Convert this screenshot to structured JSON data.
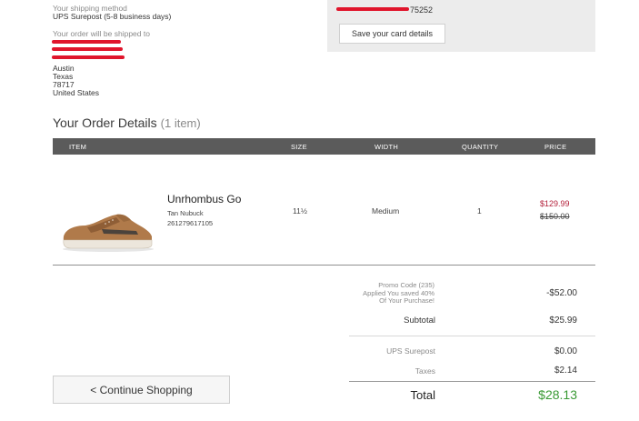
{
  "shipping": {
    "method_label": "Your shipping method",
    "method_value": "UPS Surepost (5-8 business days)",
    "ship_to_label": "Your order will be shipped to",
    "address_lines": [
      "Austin",
      "Texas",
      "78717",
      "United States"
    ]
  },
  "payment": {
    "card_last_digits": "75252",
    "save_card_label": "Save your card details"
  },
  "order": {
    "title": "Your Order Details",
    "item_count": "(1 item)",
    "columns": [
      "ITEM",
      "SIZE",
      "WIDTH",
      "QUANTITY",
      "PRICE"
    ],
    "item": {
      "name": "Unrhombus Go",
      "color": "Tan Nubuck",
      "sku": "261279617105",
      "size": "11½",
      "width": "Medium",
      "quantity": "1",
      "sale_price": "$129.99",
      "original_price": "$150.00"
    }
  },
  "summary": {
    "promo_lines": [
      "Promo Code (235)",
      "Applied You saved 40%",
      "Of Your Purchase!"
    ],
    "promo_amount": "-$52.00",
    "subtotal_label": "Subtotal",
    "subtotal_amount": "$25.99",
    "shipping_label": "UPS Surepost",
    "shipping_amount": "$0.00",
    "taxes_label": "Taxes",
    "taxes_amount": "$2.14",
    "total_label": "Total",
    "total_amount": "$28.13"
  },
  "actions": {
    "continue_shopping": "< Continue Shopping"
  },
  "colors": {
    "header_bar": "#5b5b5b",
    "sale_price": "#b3203a",
    "total": "#3a9a35",
    "redaction": "#e0152c"
  }
}
